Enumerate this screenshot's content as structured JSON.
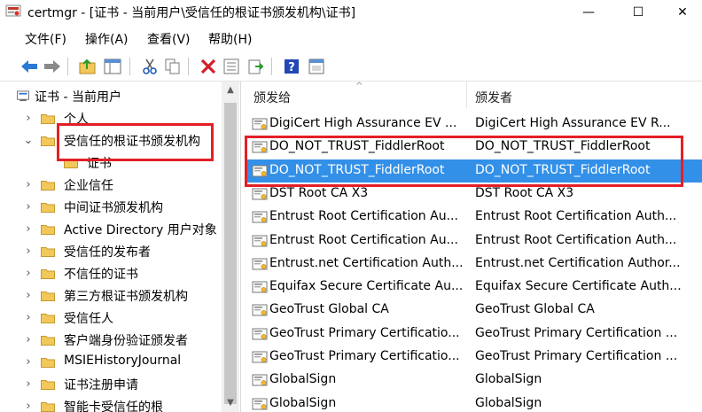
{
  "window": {
    "title": "certmgr - [证书 - 当前用户\\受信任的根证书颁发机构\\证书]",
    "minimize": "—",
    "maximize": "☐",
    "close": "✕"
  },
  "menu": [
    "文件(F)",
    "操作(A)",
    "查看(V)",
    "帮助(H)"
  ],
  "toolbar_icons": [
    "back-icon",
    "forward-icon",
    "up-folder-icon",
    "show-hide-tree-icon",
    "cut-icon",
    "copy-icon",
    "delete-icon",
    "properties-icon",
    "export-icon",
    "help-icon",
    "view-icon"
  ],
  "tree": {
    "root": "证书 - 当前用户",
    "items": [
      {
        "label": "个人",
        "expander": "›"
      },
      {
        "label": "受信任的根证书颁发机构",
        "expander": "⌄"
      },
      {
        "label": "证书",
        "expander": ""
      },
      {
        "label": "企业信任",
        "expander": "›"
      },
      {
        "label": "中间证书颁发机构",
        "expander": "›"
      },
      {
        "label": "Active Directory 用户对象",
        "expander": "›"
      },
      {
        "label": "受信任的发布者",
        "expander": "›"
      },
      {
        "label": "不信任的证书",
        "expander": "›"
      },
      {
        "label": "第三方根证书颁发机构",
        "expander": "›"
      },
      {
        "label": "受信任人",
        "expander": "›"
      },
      {
        "label": "客户端身份验证颁发者",
        "expander": "›"
      },
      {
        "label": "MSIEHistoryJournal",
        "expander": "›"
      },
      {
        "label": "证书注册申请",
        "expander": "›"
      },
      {
        "label": "智能卡受信任的根",
        "expander": "›"
      }
    ]
  },
  "list": {
    "columns": {
      "issued_to": "颁发给",
      "issued_by": "颁发者"
    },
    "sort_indicator": "^",
    "rows": [
      {
        "issued_to": "DigiCert High Assurance EV ...",
        "issued_by": "DigiCert High Assurance EV R..."
      },
      {
        "issued_to": "DO_NOT_TRUST_FiddlerRoot",
        "issued_by": "DO_NOT_TRUST_FiddlerRoot"
      },
      {
        "issued_to": "DO_NOT_TRUST_FiddlerRoot",
        "issued_by": "DO_NOT_TRUST_FiddlerRoot"
      },
      {
        "issued_to": "DST Root CA X3",
        "issued_by": "DST Root CA X3"
      },
      {
        "issued_to": "Entrust Root Certification Au...",
        "issued_by": "Entrust Root Certification Auth..."
      },
      {
        "issued_to": "Entrust Root Certification Au...",
        "issued_by": "Entrust Root Certification Auth..."
      },
      {
        "issued_to": "Entrust.net Certification Auth...",
        "issued_by": "Entrust.net Certification Author..."
      },
      {
        "issued_to": "Equifax Secure Certificate Au...",
        "issued_by": "Equifax Secure Certificate Auth..."
      },
      {
        "issued_to": "GeoTrust Global CA",
        "issued_by": "GeoTrust Global CA"
      },
      {
        "issued_to": "GeoTrust Primary Certificatio...",
        "issued_by": "GeoTrust Primary Certification ..."
      },
      {
        "issued_to": "GeoTrust Primary Certificatio...",
        "issued_by": "GeoTrust Primary Certification ..."
      },
      {
        "issued_to": "GlobalSign",
        "issued_by": "GlobalSign"
      },
      {
        "issued_to": "GlobalSign",
        "issued_by": "GlobalSign"
      }
    ]
  },
  "colors": {
    "selection": "#3390e8",
    "highlight_box": "#e31f26",
    "folder": "#f3c85b"
  }
}
